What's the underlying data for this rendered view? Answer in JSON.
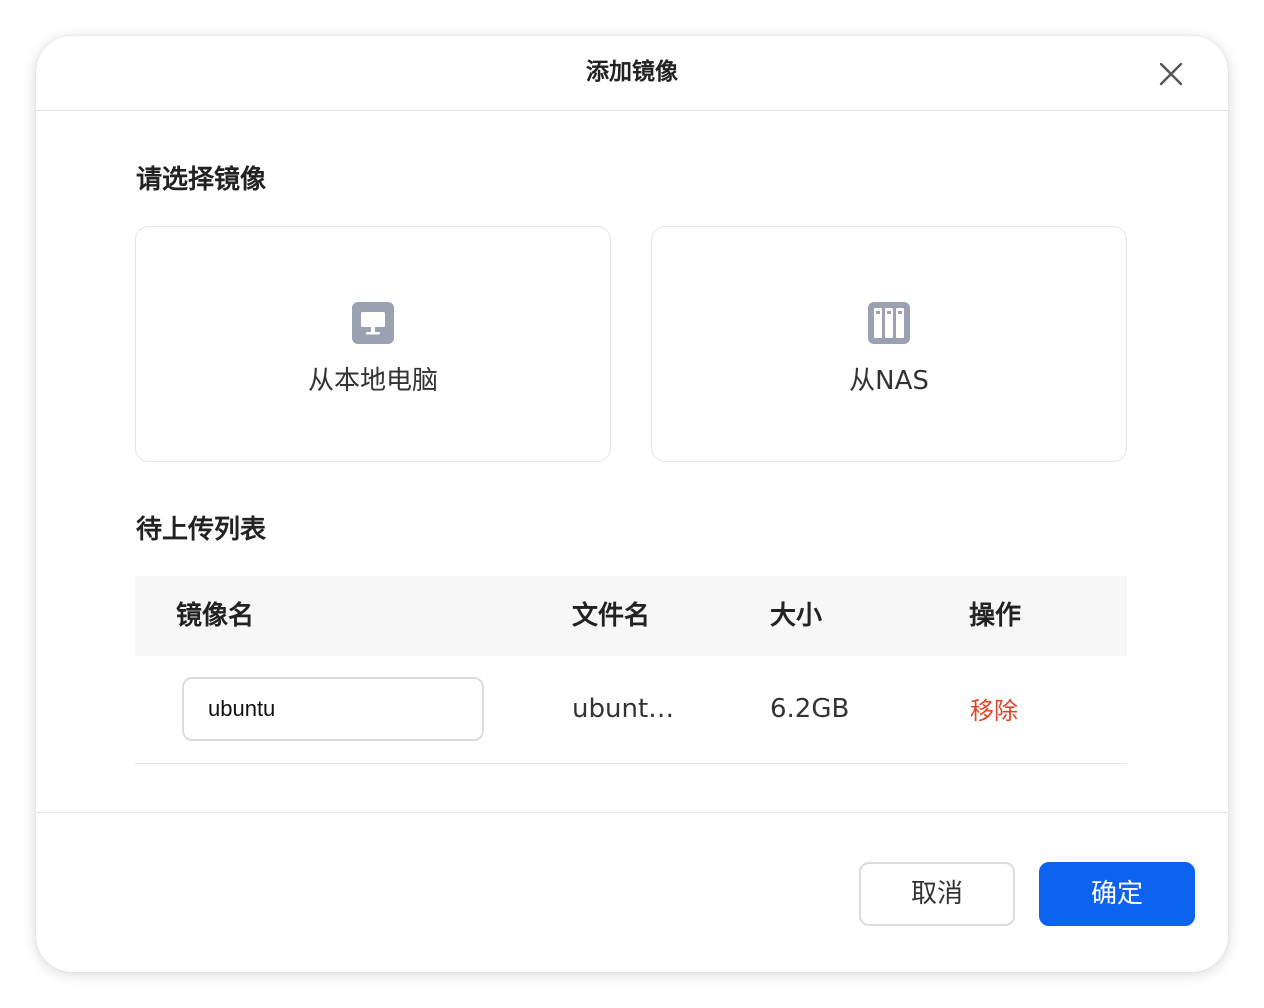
{
  "dialog": {
    "title": "添加镜像",
    "close_icon": "close-icon"
  },
  "select_section": {
    "title": "请选择镜像",
    "options": [
      {
        "label": "从本地电脑",
        "icon": "computer-icon"
      },
      {
        "label": "从NAS",
        "icon": "nas-icon"
      }
    ]
  },
  "upload_section": {
    "title": "待上传列表",
    "columns": [
      "镜像名",
      "文件名",
      "大小",
      "操作"
    ],
    "rows": [
      {
        "image_name": "ubuntu",
        "file_name": "ubuntu…",
        "size": "6.2GB",
        "action": "移除"
      }
    ]
  },
  "footer": {
    "cancel_label": "取消",
    "confirm_label": "确定"
  },
  "colors": {
    "primary": "#0b63f0",
    "danger": "#e0442a",
    "icon_gray": "#9aa1b1"
  }
}
